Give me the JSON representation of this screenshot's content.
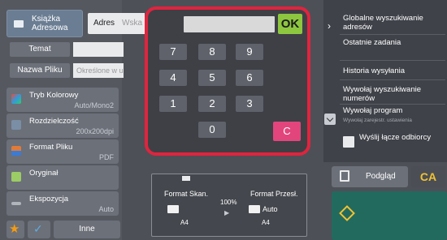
{
  "left": {
    "address_book_label": "Książka\nAdresowa",
    "address_tab_label": "Adres",
    "address_tab_partial": "Wska",
    "subject_label": "Temat",
    "filename_label": "Nazwa Pliku",
    "filename_placeholder": "Określone w ustaw",
    "settings": [
      {
        "title": "Tryb Kolorowy",
        "value": "Auto/Mono2",
        "icon": "color-mode-icon",
        "color": "#c0392b"
      },
      {
        "title": "Rozdzielczość",
        "value": "200x200dpi",
        "icon": "resolution-icon",
        "color": "#7a8ea6"
      },
      {
        "title": "Format Pliku",
        "value": "PDF",
        "icon": "file-format-icon",
        "color": "#e07b39"
      },
      {
        "title": "Oryginał",
        "value": "",
        "icon": "original-icon",
        "color": "#9ccc65"
      },
      {
        "title": "Ekspozycja",
        "value": "Auto",
        "icon": "exposure-icon",
        "color": "#b0b4bb"
      }
    ],
    "others_label": "Inne"
  },
  "keypad": {
    "ok_label": "OK",
    "clear_label": "C",
    "keys": [
      "7",
      "8",
      "9",
      "4",
      "5",
      "6",
      "1",
      "2",
      "3",
      "0"
    ]
  },
  "formats": {
    "scan_label": "Format Skan.",
    "send_label": "Format Przesł.",
    "ratio": "100%",
    "scan_size": "A4",
    "send_size": "A4",
    "send_mode": "Auto"
  },
  "right": {
    "menu_items": [
      "Globalne wyszukiwanie adresów",
      "Ostatnie zadania",
      "Historia wysyłania",
      "Wywołaj wyszukiwanie numerów",
      "Wywołaj program"
    ],
    "program_sub": "Wywołaj zarejestr. ustawienia",
    "send_receipt_label": "Wyślij łącze odbiorcy",
    "preview_label": "Podgląd",
    "ca_label": "CA"
  },
  "colors": {
    "ok": "#8dc63f",
    "clear": "#e2457c",
    "frame": "#e0243e",
    "start": "#236a5e"
  }
}
